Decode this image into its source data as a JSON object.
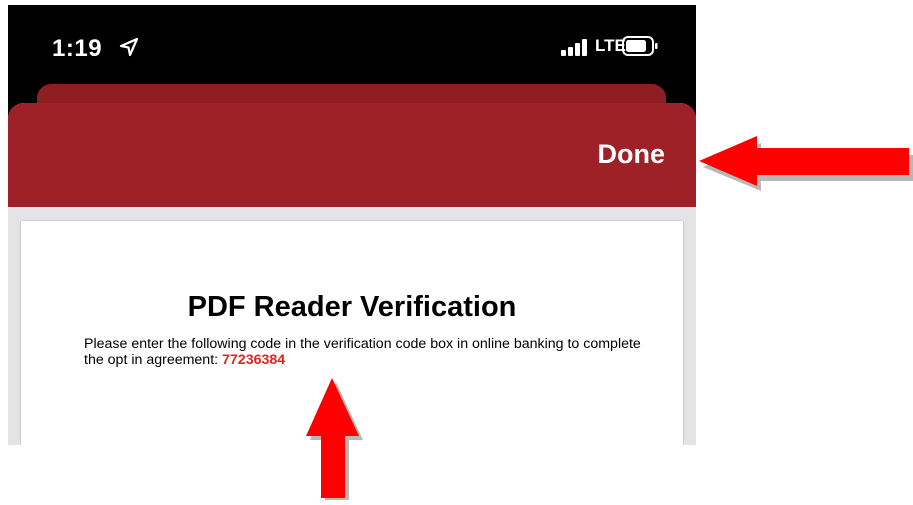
{
  "status_bar": {
    "time": "1:19",
    "carrier": "LTE",
    "icons": [
      "location-arrow-icon",
      "signal-bars-icon",
      "battery-icon"
    ]
  },
  "nav_bar": {
    "done_label": "Done",
    "color": "#9d2126"
  },
  "document": {
    "title": "PDF Reader Verification",
    "body_text": "Please enter the following code in the verification code box in online banking to complete the opt in agreement: ",
    "code": "77236384",
    "code_color": "#e2241f"
  },
  "annotations": {
    "arrow_color": "#ff0000",
    "icons": [
      "arrow-left-icon",
      "arrow-up-icon"
    ]
  }
}
